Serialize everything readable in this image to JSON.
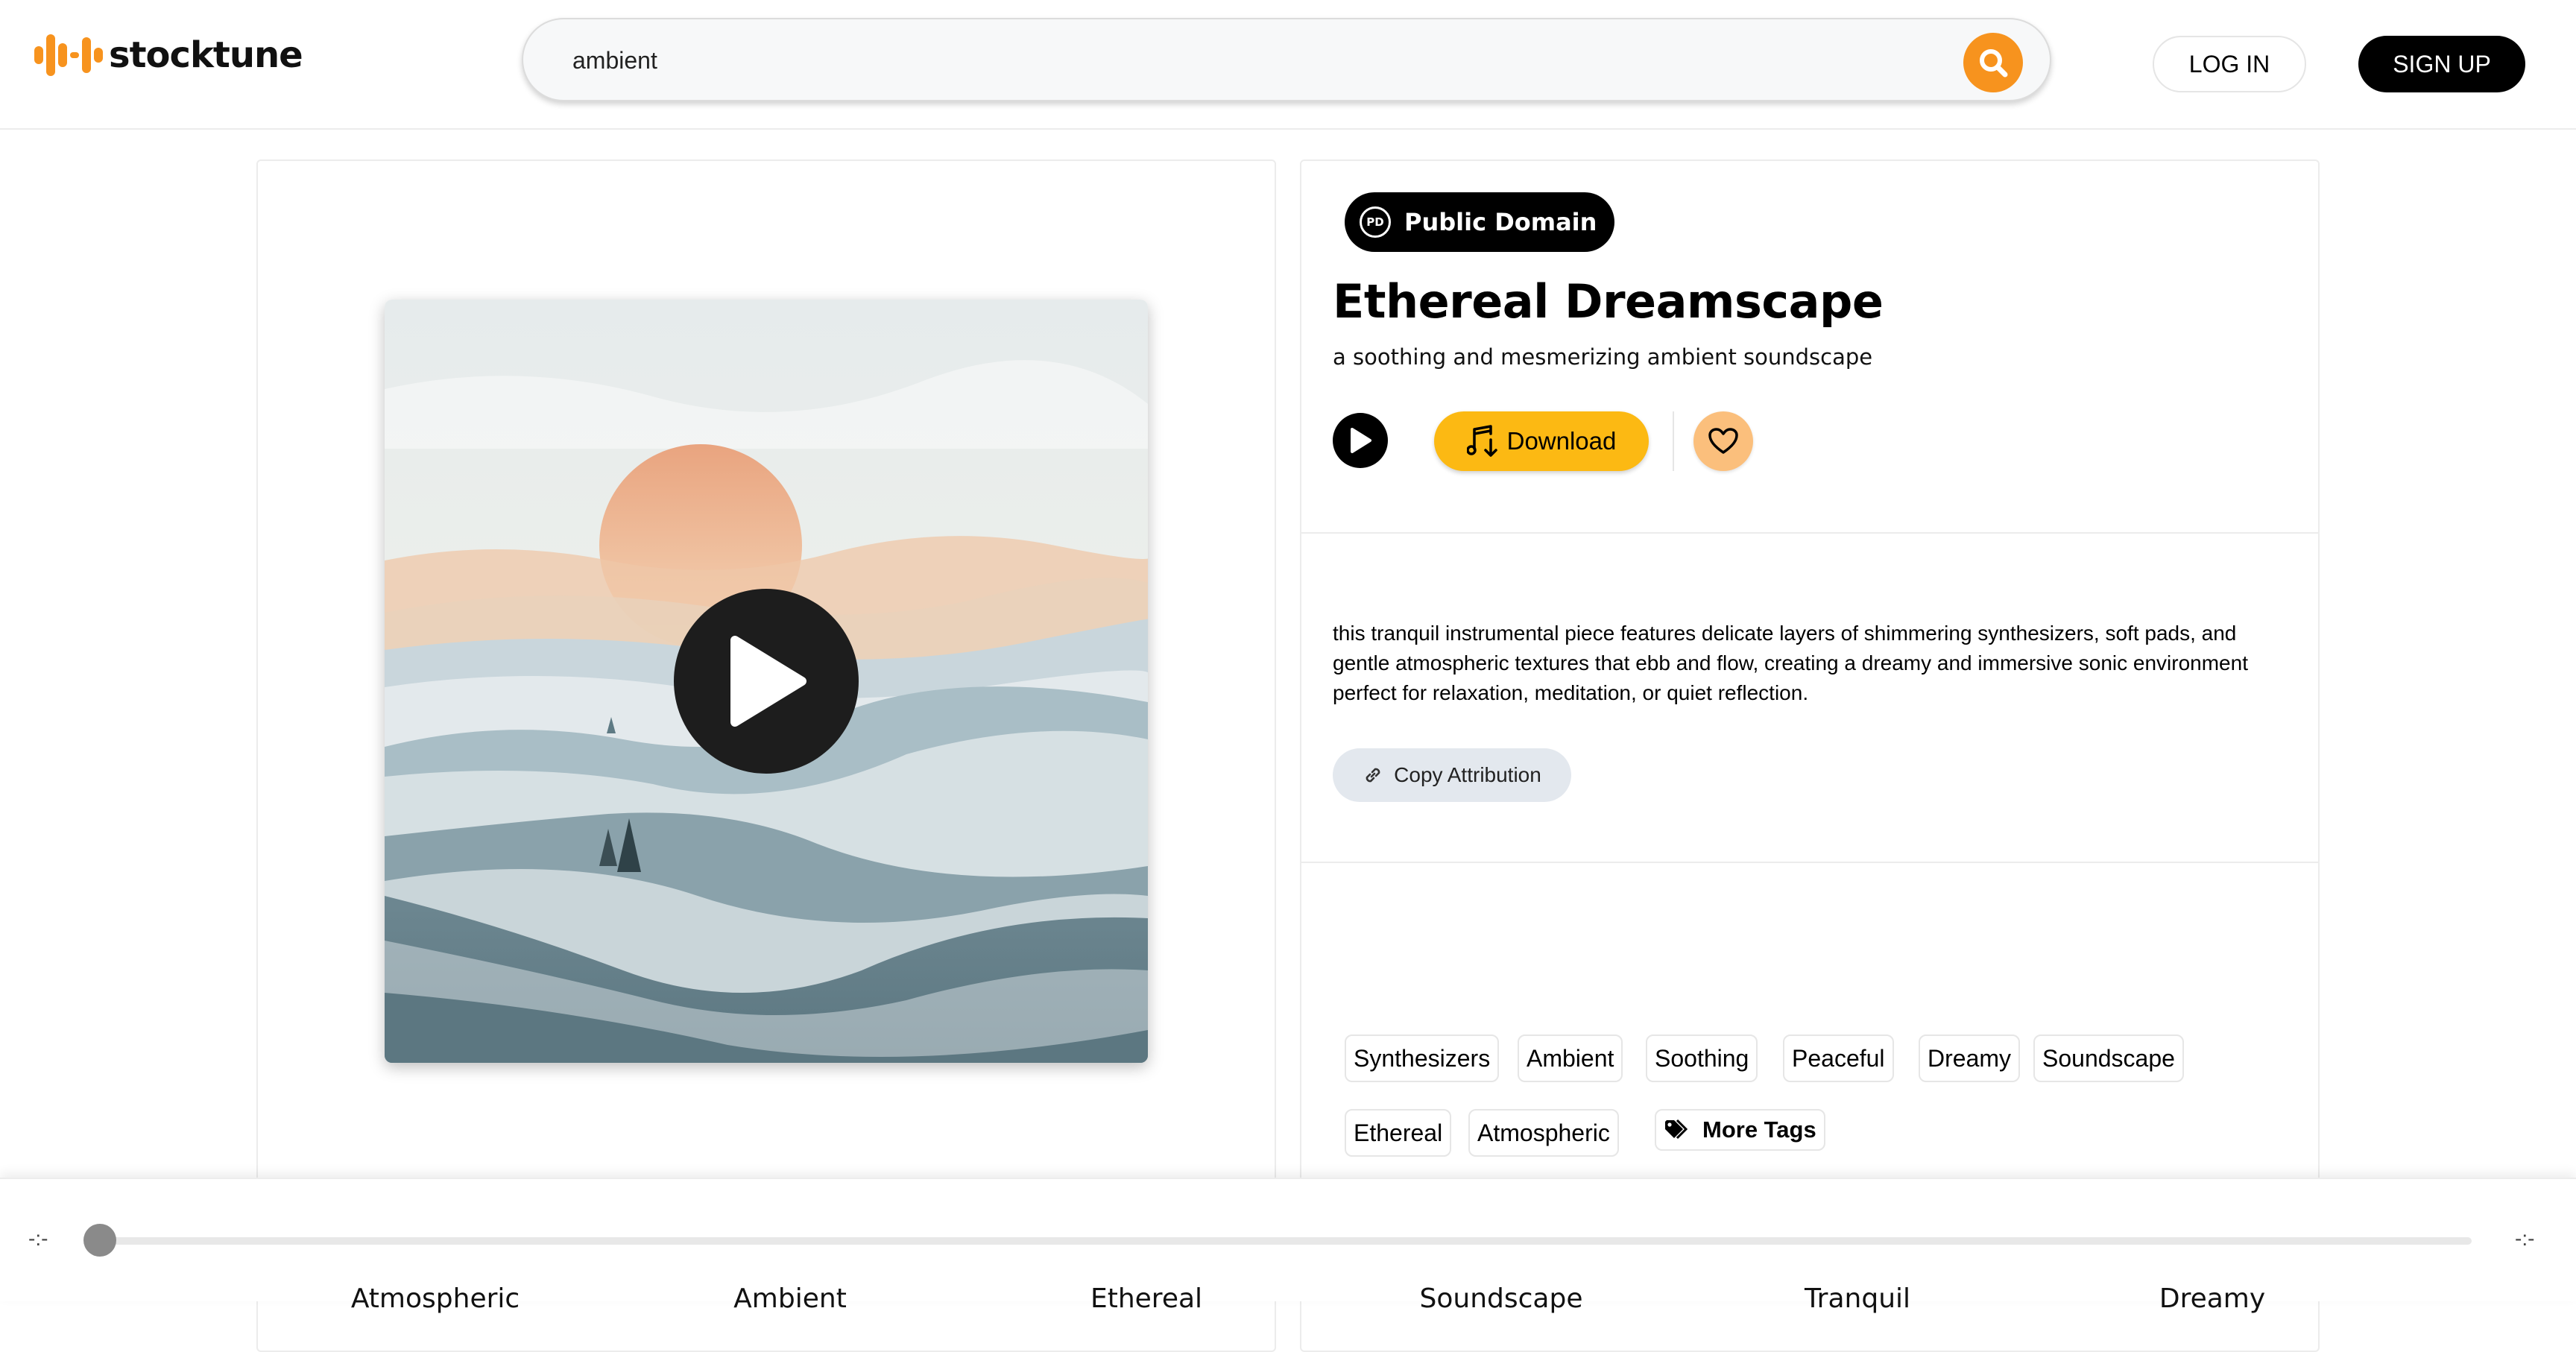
{
  "header": {
    "brand": "stocktune",
    "search_value": "ambient",
    "login_label": "LOG IN",
    "signup_label": "SIGN UP"
  },
  "track": {
    "license_icon": "PD",
    "license": "Public Domain",
    "title": "Ethereal Dreamscape",
    "subtitle": "a soothing and mesmerizing ambient soundscape",
    "download_label": "Download",
    "description": "this tranquil instrumental piece features delicate layers of shimmering synthesizers, soft pads, and gentle atmospheric textures that ebb and flow, creating a dreamy and immersive sonic environment perfect for relaxation, meditation, or quiet reflection.",
    "copy_attribution_label": "Copy Attribution"
  },
  "tags": [
    "Synthesizers",
    "Ambient",
    "Soothing",
    "Peaceful",
    "Dreamy",
    "Soundscape",
    "Ethereal",
    "Atmospheric"
  ],
  "more_tags_label": "More Tags",
  "player": {
    "current_time": "-:-",
    "total_time": "-:-",
    "progress": 0
  },
  "related_categories": [
    "Atmospheric",
    "Ambient",
    "Ethereal",
    "Soundscape",
    "Tranquil",
    "Dreamy"
  ],
  "colors": {
    "brand_orange": "#f7931e",
    "download_yellow": "#fcb913",
    "favorite_peach": "#fbbf7c",
    "badge_black": "#000000"
  },
  "icons": {
    "logo": "waveform-logo-icon",
    "search": "search-icon",
    "play": "play-icon",
    "download": "music-download-icon",
    "favorite": "heart-icon",
    "attribution": "link-icon",
    "more_tags": "tags-icon"
  }
}
